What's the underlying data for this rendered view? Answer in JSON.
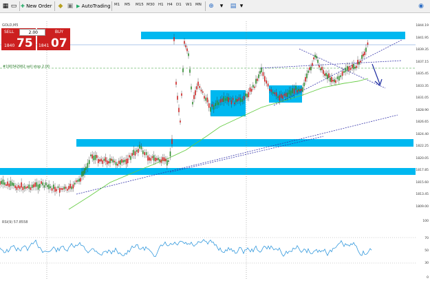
{
  "toolbar": {
    "new_order_label": "New Order",
    "autotrading_label": "AutoTrading",
    "timeframes": [
      "M1",
      "M5",
      "M15",
      "M30",
      "H1",
      "H4",
      "D1",
      "W1",
      "MN"
    ]
  },
  "chart": {
    "symbol_label": "GOLD,M5",
    "pending_order_label": "#190342962 sell stop 2.00",
    "rsi_label": "RSI(9) 57.8558",
    "price_axis": [
      "1844.19",
      "1841.95",
      "1839.35",
      "1837.15",
      "1835.45",
      "1833.35",
      "1831.05",
      "1828.90",
      "1826.65",
      "1824.40",
      "1822.25",
      "1820.05",
      "1817.85",
      "1815.60",
      "1813.45",
      "1809.00"
    ],
    "rsi_axis": [
      "100",
      "70",
      "50",
      "30",
      "0"
    ],
    "colors": {
      "zone": "#00b8f0",
      "trend": "#3333aa",
      "ma": "#66cc44",
      "candle_bull": "#2d8a2d",
      "candle_bear": "#cc2222",
      "rsi": "#3399dd"
    }
  },
  "trade_panel": {
    "sell_label": "SELL",
    "buy_label": "BUY",
    "lot_value": "2.00",
    "sell_price_small": "1840",
    "sell_price_big": "75",
    "buy_price_small": "1841",
    "buy_price_big": "07"
  }
}
